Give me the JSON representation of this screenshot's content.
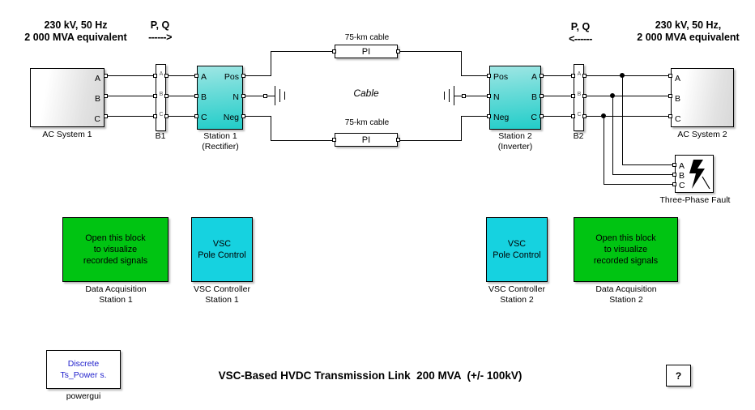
{
  "diagram": {
    "title": "VSC-Based HVDC Transmission Link  200 MVA  (+/- 100kV)",
    "help_label": "?"
  },
  "annotations": {
    "left_source": "230 kV, 50 Hz\n2 000 MVA equivalent",
    "left_pq": "P, Q",
    "left_arrow": "------>",
    "right_pq": "P, Q",
    "right_arrow": "<------",
    "right_source": "230 kV, 50 Hz,\n2 000 MVA equivalent",
    "cable_word": "Cable"
  },
  "blocks": {
    "ac_system_1": {
      "caption": "AC System 1",
      "ports": [
        "A",
        "B",
        "C"
      ]
    },
    "breaker_1": {
      "caption": "B1",
      "phase_labels": [
        "A",
        "B",
        "C"
      ]
    },
    "station_1": {
      "caption": "Station 1\n(Rectifier)",
      "left_ports": [
        "A",
        "B",
        "C"
      ],
      "right_ports": [
        "Pos",
        "N",
        "Neg"
      ]
    },
    "cable_top": {
      "label": "75-km cable",
      "inner": "PI"
    },
    "cable_bottom": {
      "label": "75-km cable",
      "inner": "PI"
    },
    "station_2": {
      "caption": "Station 2\n(Inverter)",
      "left_ports": [
        "Pos",
        "N",
        "Neg"
      ],
      "right_ports": [
        "A",
        "B",
        "C"
      ]
    },
    "breaker_2": {
      "caption": "B2",
      "phase_labels": [
        "A",
        "B",
        "C"
      ]
    },
    "ac_system_2": {
      "caption": "AC System 2",
      "ports": [
        "A",
        "B",
        "C"
      ]
    },
    "three_phase_fault": {
      "caption": "Three-Phase Fault",
      "ports": [
        "A",
        "B",
        "C"
      ]
    },
    "data_acq_1": {
      "inner": "Open this block\nto visualize\nrecorded signals",
      "caption": "Data Acquisition\nStation 1",
      "color": "#00C412"
    },
    "vsc_ctrl_1": {
      "inner": "VSC\nPole Control",
      "caption": "VSC Controller\nStation 1",
      "color": "#16D2E0"
    },
    "vsc_ctrl_2": {
      "inner": "VSC\nPole Control",
      "caption": "VSC Controller\nStation 2",
      "color": "#16D2E0"
    },
    "data_acq_2": {
      "inner": "Open this block\nto visualize\nrecorded signals",
      "caption": "Data Acquisition\nStation 2",
      "color": "#00C412"
    },
    "powergui": {
      "inner": "Discrete\nTs_Power s.",
      "caption": "powergui",
      "text_color": "#2222cc"
    }
  },
  "colors": {
    "station_fill": "#22cdc9",
    "green_fill": "#00C412",
    "cyan_fill": "#16D2E0",
    "wire": "#000000",
    "canvas": "#ffffff"
  }
}
